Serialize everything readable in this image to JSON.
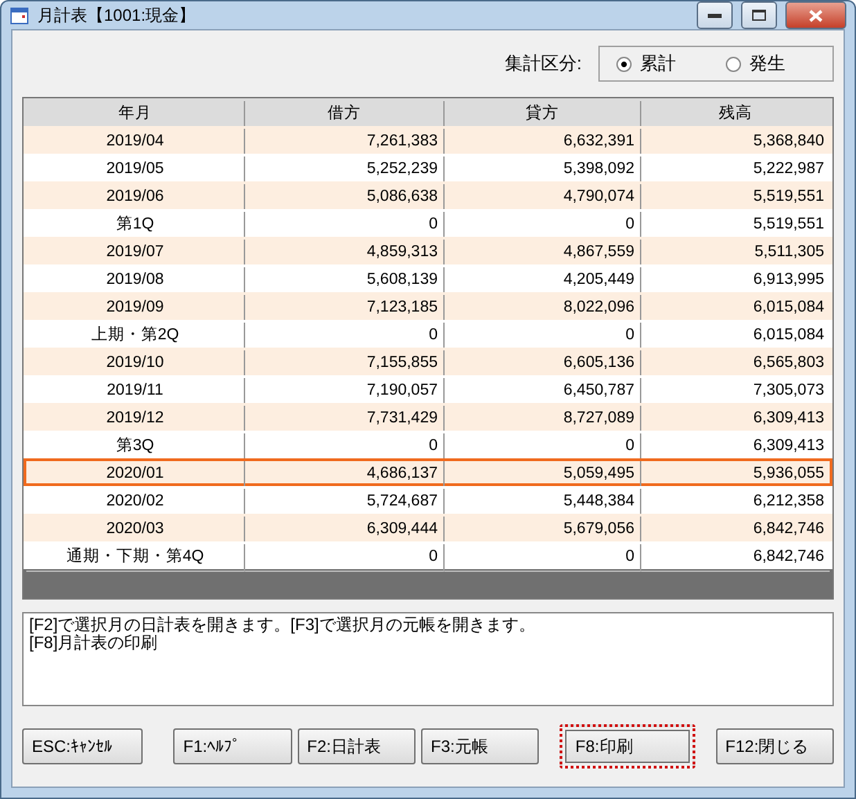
{
  "window": {
    "title": "月計表【1001:現金】"
  },
  "summary_mode": {
    "label": "集計区分:",
    "options": [
      {
        "label": "累計",
        "selected": true
      },
      {
        "label": "発生",
        "selected": false
      }
    ]
  },
  "table": {
    "columns": [
      "年月",
      "借方",
      "貸方",
      "残高"
    ],
    "rows": [
      {
        "cells": [
          "2019/04",
          "7,261,383",
          "6,632,391",
          "5,368,840"
        ],
        "selected": false
      },
      {
        "cells": [
          "2019/05",
          "5,252,239",
          "5,398,092",
          "5,222,987"
        ],
        "selected": false
      },
      {
        "cells": [
          "2019/06",
          "5,086,638",
          "4,790,074",
          "5,519,551"
        ],
        "selected": false
      },
      {
        "cells": [
          "第1Q",
          "0",
          "0",
          "5,519,551"
        ],
        "selected": false
      },
      {
        "cells": [
          "2019/07",
          "4,859,313",
          "4,867,559",
          "5,511,305"
        ],
        "selected": false
      },
      {
        "cells": [
          "2019/08",
          "5,608,139",
          "4,205,449",
          "6,913,995"
        ],
        "selected": false
      },
      {
        "cells": [
          "2019/09",
          "7,123,185",
          "8,022,096",
          "6,015,084"
        ],
        "selected": false
      },
      {
        "cells": [
          "上期・第2Q",
          "0",
          "0",
          "6,015,084"
        ],
        "selected": false
      },
      {
        "cells": [
          "2019/10",
          "7,155,855",
          "6,605,136",
          "6,565,803"
        ],
        "selected": false
      },
      {
        "cells": [
          "2019/11",
          "7,190,057",
          "6,450,787",
          "7,305,073"
        ],
        "selected": false
      },
      {
        "cells": [
          "2019/12",
          "7,731,429",
          "8,727,089",
          "6,309,413"
        ],
        "selected": false
      },
      {
        "cells": [
          "第3Q",
          "0",
          "0",
          "6,309,413"
        ],
        "selected": false
      },
      {
        "cells": [
          "2020/01",
          "4,686,137",
          "5,059,495",
          "5,936,055"
        ],
        "selected": true
      },
      {
        "cells": [
          "2020/02",
          "5,724,687",
          "5,448,384",
          "6,212,358"
        ],
        "selected": false
      },
      {
        "cells": [
          "2020/03",
          "6,309,444",
          "5,679,056",
          "6,842,746"
        ],
        "selected": false
      },
      {
        "cells": [
          "通期・下期・第4Q",
          "0",
          "0",
          "6,842,746"
        ],
        "selected": false
      }
    ]
  },
  "message": [
    "[F2]で選択月の日計表を開きます。[F3]で選択月の元帳を開きます。",
    "[F8]月計表の印刷"
  ],
  "buttons": [
    {
      "label": "ESC:ｷｬﾝｾﾙ",
      "focused": false
    },
    {
      "label": "F1:ﾍﾙﾌﾟ",
      "focused": false
    },
    {
      "label": "F2:日計表",
      "focused": false
    },
    {
      "label": "F3:元帳",
      "focused": false
    },
    {
      "label": "F8:印刷",
      "focused": true
    },
    {
      "label": "F12:閉じる",
      "focused": false
    }
  ]
}
